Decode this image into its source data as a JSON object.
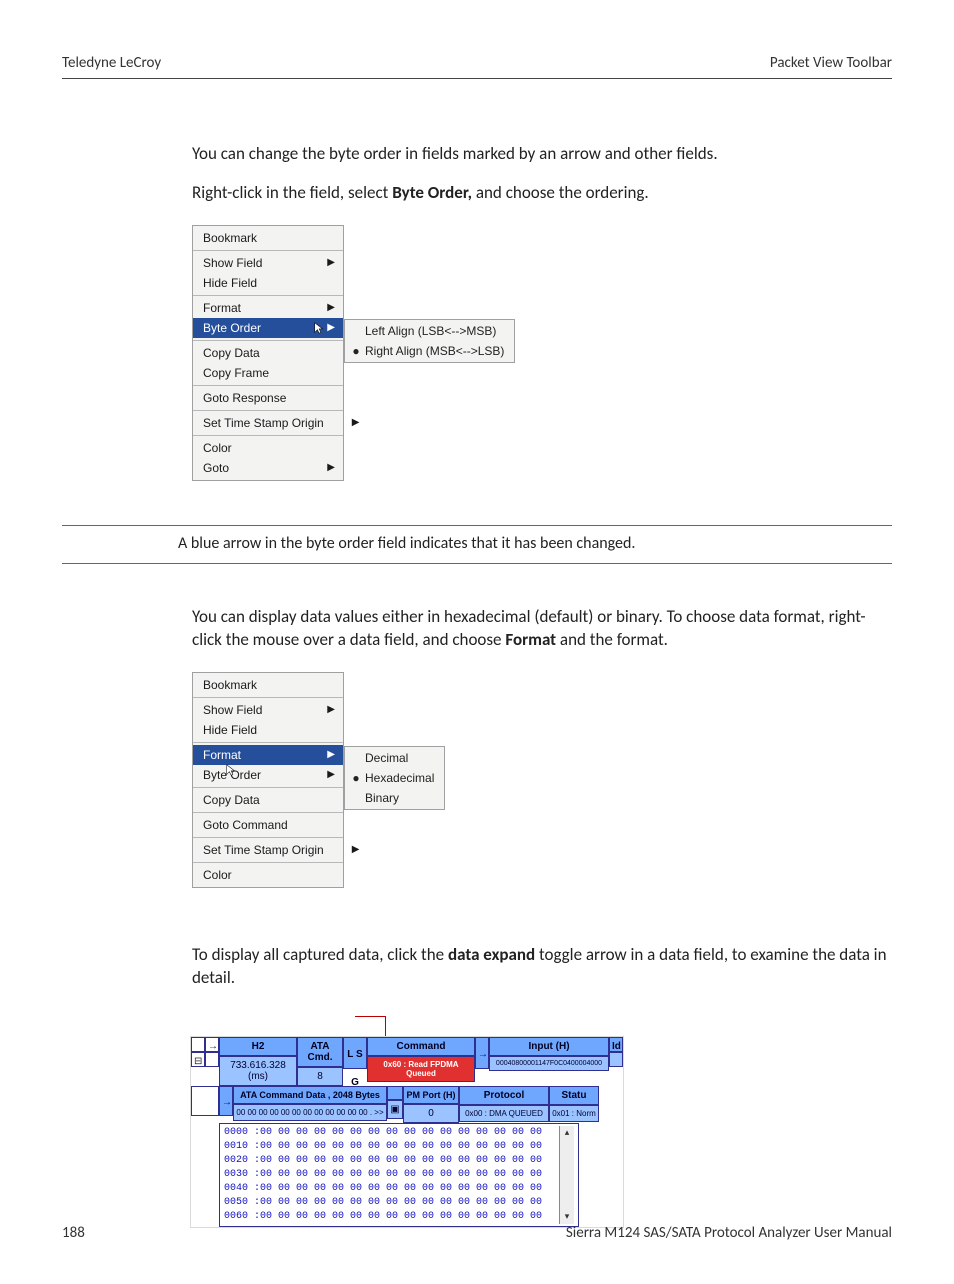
{
  "header": {
    "left": "Teledyne LeCroy",
    "right": "Packet View Toolbar"
  },
  "footer": {
    "page": "188",
    "manual": "Sierra M124 SAS/SATA Protocol Analyzer User Manual"
  },
  "body": {
    "p1_a": "You can change the byte order in fields marked by an arrow and other fields.",
    "p2_a": "Right-click in the field, select ",
    "p2_b": "Byte Order,",
    "p2_c": " and choose the ordering.",
    "note": "A blue arrow in the byte order field indicates that it has been changed.",
    "p3_a": "You can display data values either in hexadecimal (default) or binary. To choose data format, right-click the mouse over a data field, and choose ",
    "p3_b": "Format",
    "p3_c": " and the format.",
    "p4_a": "To display all captured data, click the ",
    "p4_b": "data expand",
    "p4_c": " toggle arrow in a data field, to examine the data in detail."
  },
  "menu1": {
    "items": [
      "Bookmark",
      "Show Field",
      "Hide Field",
      "Format",
      "Byte Order",
      "Copy Data",
      "Copy Frame",
      "Goto Response",
      "Set Time Stamp Origin",
      "Color",
      "Goto"
    ],
    "submenu": [
      "Left Align (LSB<-->MSB)",
      "Right Align (MSB<-->LSB)"
    ]
  },
  "menu2": {
    "items": [
      "Bookmark",
      "Show Field",
      "Hide Field",
      "Format",
      "Byte Order",
      "Copy Data",
      "Goto Command",
      "Set Time Stamp Origin",
      "Color"
    ],
    "submenu": [
      "Decimal",
      "Hexadecimal",
      "Binary"
    ]
  },
  "packet": {
    "row1": {
      "h2_h": "H2",
      "h2_v": "733.616.328 (ms)",
      "ata_h": "ATA Cmd.",
      "ata_v": "8",
      "lso": "L S G",
      "cmd_h": "Command",
      "cmd_v": "0x60 : Read FPDMA Queued",
      "arrow": "→",
      "input_h": "Input (H)",
      "input_v": "00040800001147F0C0400004000",
      "idx": "Id"
    },
    "row2": {
      "arrow": "→",
      "atad_h": "ATA Command Data , 2048 Bytes",
      "atad_v": "00 00 00 00 00 00 00 00 00 00 00 00 .  >>",
      "toggle": "▣",
      "pm_h": "PM Port (H)",
      "pm_v": "0",
      "proto_h": "Protocol",
      "proto_v": "0x00 : DMA QUEUED",
      "stat_h": "Statu",
      "stat_v": "0x01 : Norm"
    },
    "hex": [
      "0000 :00 00 00 00 00 00 00 00 00 00 00 00 00 00 00 00",
      "0010 :00 00 00 00 00 00 00 00 00 00 00 00 00 00 00 00",
      "0020 :00 00 00 00 00 00 00 00 00 00 00 00 00 00 00 00",
      "0030 :00 00 00 00 00 00 00 00 00 00 00 00 00 00 00 00",
      "0040 :00 00 00 00 00 00 00 00 00 00 00 00 00 00 00 00",
      "0050 :00 00 00 00 00 00 00 00 00 00 00 00 00 00 00 00",
      "0060 :00 00 00 00 00 00 00 00 00 00 00 00 00 00 00 00"
    ]
  }
}
